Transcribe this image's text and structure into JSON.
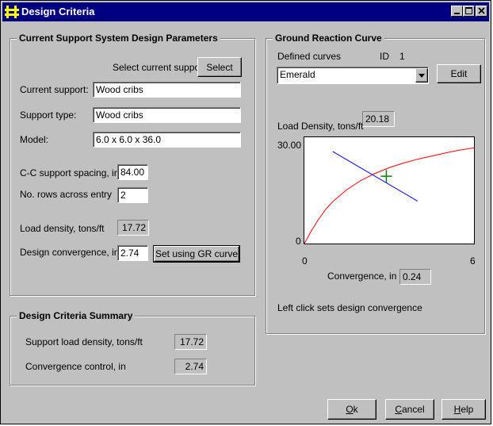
{
  "window": {
    "title": "Design Criteria"
  },
  "support_group": {
    "title": "Current Support System Design Parameters",
    "select_label": "Select current support",
    "select_button": "Select",
    "current_support_label": "Current support:",
    "current_support_value": "Wood cribs",
    "support_type_label": "Support type:",
    "support_type_value": "Wood cribs",
    "model_label": "Model:",
    "model_value": "6.0 x 6.0 x 36.0",
    "spacing_label": "C-C support spacing, in",
    "spacing_value": "84.00",
    "rows_label": "No. rows across entry",
    "rows_value": "2",
    "load_density_label": "Load density, tons/ft",
    "load_density_value": "17.72",
    "convergence_label": "Design convergence, in",
    "convergence_value": "2.74",
    "set_gr_button": "Set using GR curve"
  },
  "summary_group": {
    "title": "Design Criteria Summary",
    "load_label": "Support load density, tons/ft",
    "load_value": "17.72",
    "convergence_label": "Convergence control, in",
    "convergence_value": "2.74"
  },
  "grc_group": {
    "title": "Ground Reaction Curve",
    "defined_curves_label": "Defined curves",
    "id_label": "ID",
    "id_value": "1",
    "curve_selected": "Emerald",
    "edit_button": "Edit",
    "load_density_label": "Load Density, tons/ft",
    "load_density_value": "20.18",
    "convergence_label": "Convergence, in",
    "convergence_value": "0.24",
    "hint": "Left click sets design convergence"
  },
  "chart_data": {
    "type": "line",
    "ylim": [
      0,
      30
    ],
    "xlim": [
      0,
      6
    ],
    "y_tick_labels": [
      "30.00",
      "0"
    ],
    "x_tick_labels": [
      "0",
      "6"
    ],
    "series": [
      {
        "color": "#ff0000",
        "x": [
          0,
          0.25,
          0.5,
          0.75,
          1.0,
          1.5,
          2.0,
          2.5,
          3.0,
          3.5,
          4.0,
          4.5,
          5.0,
          5.5,
          6.0
        ],
        "y": [
          0,
          3.6,
          6.8,
          9.6,
          11.8,
          15.2,
          17.8,
          19.8,
          21.4,
          22.7,
          23.8,
          24.7,
          25.6,
          26.4,
          27.0
        ]
      },
      {
        "color": "#0000ff",
        "x": [
          1.0,
          4.0
        ],
        "y": [
          26.0,
          12.0
        ]
      }
    ],
    "marker": {
      "color": "#008000",
      "x": 2.9,
      "y": 19.0
    }
  },
  "buttons": {
    "ok": "Ok",
    "cancel": "Cancel",
    "help": "Help"
  }
}
